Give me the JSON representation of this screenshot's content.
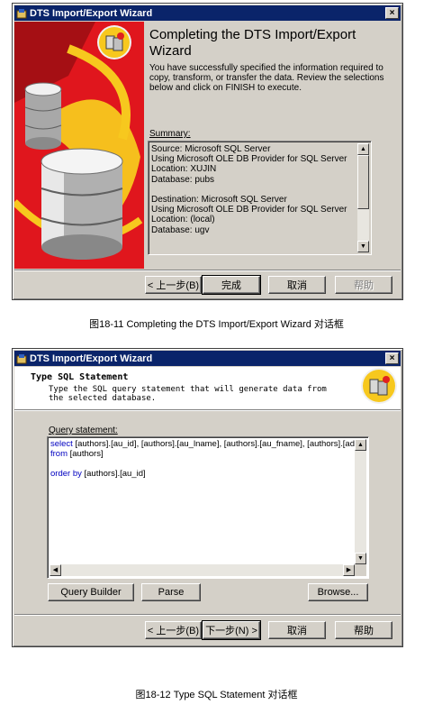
{
  "colors": {
    "title_bar": "#0a246a",
    "dialog_bg": "#d4d0c8",
    "keyword": "#0000c0",
    "banner_red": "#e0161d",
    "banner_yellow": "#f7c81e"
  },
  "dialog1": {
    "title": "DTS Import/Export Wizard",
    "close_glyph": "×",
    "heading": "Completing the DTS Import/Export Wizard",
    "description": "You have successfully specified the information required to copy, transform, or transfer the data.   Review the selections below and click on FINISH to execute.",
    "summary_label": "Summary:",
    "summary_lines": [
      "Source: Microsoft SQL Server",
      "Using Microsoft OLE DB Provider for SQL Server",
      "Location: XUJIN",
      "Database: pubs",
      "",
      "Destination: Microsoft SQL Server",
      "Using Microsoft OLE DB Provider for SQL Server",
      "Location: (local)",
      "Database: ugv"
    ],
    "buttons": {
      "back": "< 上一步(B)",
      "finish": "完成",
      "cancel": "取消",
      "help": "帮助"
    },
    "icon": "database-wizard-icon"
  },
  "caption1": "图18-11  Completing the DTS Import/Export Wizard 对话框",
  "dialog2": {
    "title": "DTS Import/Export Wizard",
    "close_glyph": "×",
    "heading": "Type SQL Statement",
    "description": "Type the SQL query statement that will generate data from the selected database.",
    "query_label": "Query statement:",
    "query": {
      "line1_keyword": "select",
      "line1_rest": " [authors].[au_id], [authors].[au_lname], [authors].[au_fname], [authors].[addre",
      "line2_keyword": "from",
      "line2_rest": " [authors]",
      "line3_keyword": "order by",
      "line3_rest": " [authors].[au_id]"
    },
    "buttons": {
      "query_builder": "Query Builder",
      "parse": "Parse",
      "browse": "Browse...",
      "back": "< 上一步(B)",
      "next": "下一步(N) >",
      "cancel": "取消",
      "help": "帮助"
    },
    "icon": "database-wizard-icon"
  },
  "caption2": "图18-12  Type SQL Statement 对话框"
}
